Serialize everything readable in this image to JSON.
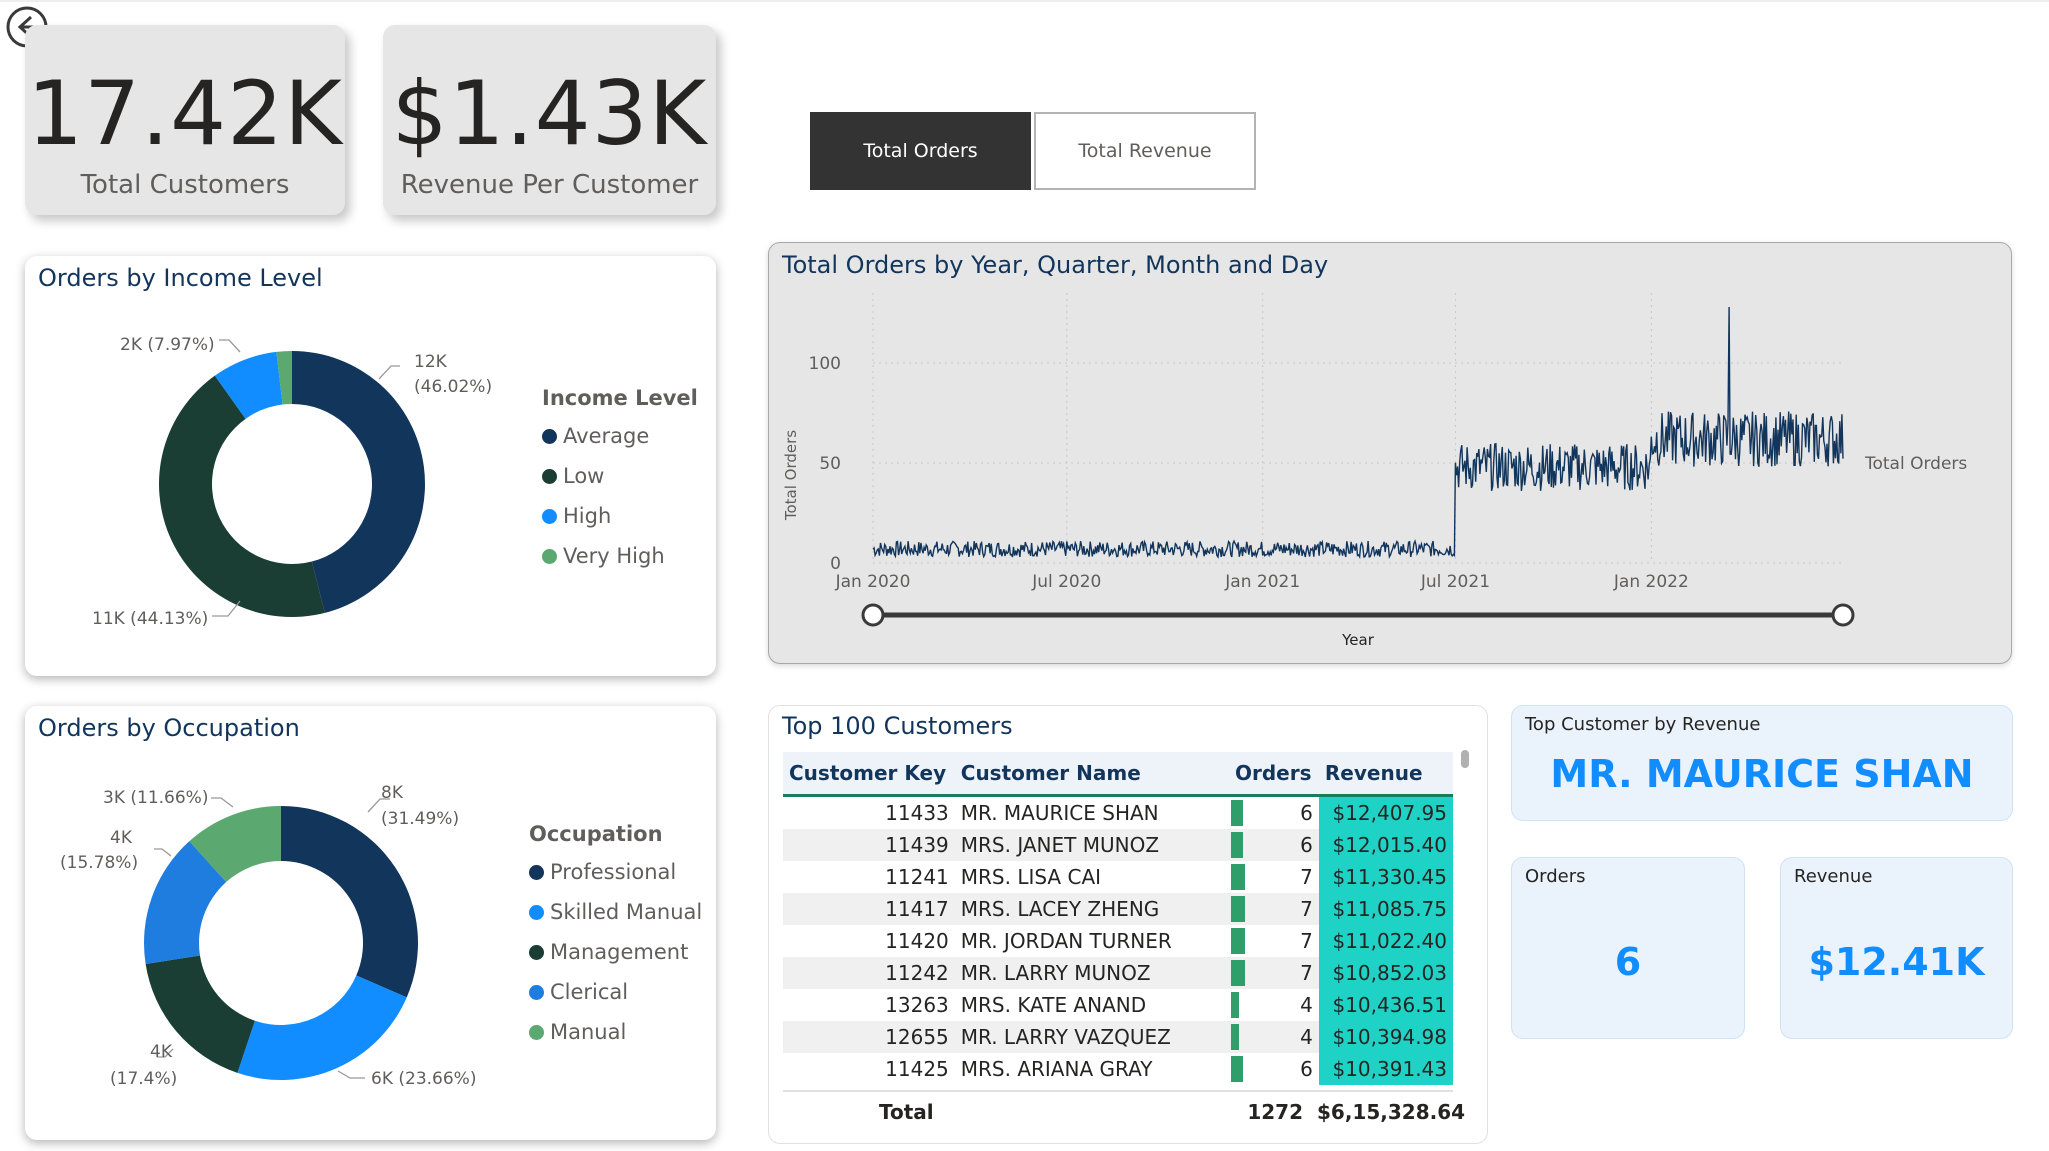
{
  "nav": {
    "back_icon": "back-arrow-icon"
  },
  "kpis": [
    {
      "value": "17.42K",
      "label": "Total Customers"
    },
    {
      "value": "$1.43K",
      "label": "Revenue Per Customer"
    }
  ],
  "toggle": {
    "orders_label": "Total Orders",
    "revenue_label": "Total Revenue",
    "active": "Total Orders"
  },
  "income_chart": {
    "title": "Orders by Income Level",
    "legend_title": "Income Level",
    "legend": [
      "Average",
      "Low",
      "High",
      "Very High"
    ],
    "colors": [
      "#12355b",
      "#1a3d34",
      "#118dff",
      "#5ba870"
    ],
    "labels": {
      "average": "12K",
      "average_pct": "(46.02%)",
      "low": "11K (44.13%)",
      "very_high": "2K (7.97%)"
    }
  },
  "occupation_chart": {
    "title": "Orders by Occupation",
    "legend_title": "Occupation",
    "legend": [
      "Professional",
      "Skilled Manual",
      "Management",
      "Clerical",
      "Manual"
    ],
    "colors": [
      "#12355b",
      "#118dff",
      "#1a3d34",
      "#1f7de0",
      "#5ba870"
    ],
    "labels": {
      "professional": "8K",
      "professional_pct": "(31.49%)",
      "skilled": "6K (23.66%)",
      "management": "4K",
      "management_pct": "(17.4%)",
      "clerical": "4K",
      "clerical_pct": "(15.78%)",
      "manual": "3K (11.66%)"
    }
  },
  "line_chart": {
    "title": "Total Orders by Year, Quarter, Month and Day",
    "ylabel": "Total Orders",
    "xlabel": "Year",
    "series_label": "Total Orders",
    "line_color": "#12355b"
  },
  "chart_data": [
    {
      "type": "pie",
      "title": "Orders by Income Level",
      "categories": [
        "Average",
        "Low",
        "High",
        "Very High"
      ],
      "values": [
        46.02,
        44.13,
        7.97,
        1.88
      ],
      "data_labels": [
        "12K (46.02%)",
        "11K (44.13%)",
        "",
        "2K (7.97%)"
      ]
    },
    {
      "type": "pie",
      "title": "Orders by Occupation",
      "categories": [
        "Professional",
        "Skilled Manual",
        "Management",
        "Clerical",
        "Manual"
      ],
      "values": [
        31.49,
        23.66,
        17.4,
        15.78,
        11.66
      ],
      "data_labels": [
        "8K (31.49%)",
        "6K (23.66%)",
        "4K (17.4%)",
        "4K (15.78%)",
        "3K (11.66%)"
      ]
    },
    {
      "type": "line",
      "title": "Total Orders by Year, Quarter, Month and Day",
      "xlabel": "",
      "ylabel": "Total Orders",
      "x_ticks": [
        "Jan 2020",
        "Jul 2020",
        "Jan 2021",
        "Jul 2021",
        "Jan 2022"
      ],
      "y_ticks": [
        0,
        50,
        100
      ],
      "ylim": [
        0,
        130
      ],
      "x_range": [
        "2020-01-01",
        "2022-06-30"
      ],
      "series": [
        {
          "name": "Total Orders",
          "segments": [
            {
              "from": "2020-01-01",
              "to": "2021-06-30",
              "base": 7,
              "noise": 4
            },
            {
              "from": "2021-07-01",
              "to": "2021-12-31",
              "base": 48,
              "noise": 12
            },
            {
              "from": "2022-01-01",
              "to": "2022-06-30",
              "base": 62,
              "noise": 14
            }
          ],
          "peak": {
            "x": "2022-03-15",
            "y": 128
          }
        }
      ]
    }
  ],
  "table": {
    "title": "Top 100 Customers",
    "columns": [
      "Customer Key",
      "Customer Name",
      "Orders",
      "Revenue"
    ],
    "rows": [
      [
        "11433",
        "MR. MAURICE SHAN",
        6,
        "$12,407.95"
      ],
      [
        "11439",
        "MRS. JANET MUNOZ",
        6,
        "$12,015.40"
      ],
      [
        "11241",
        "MRS. LISA CAI",
        7,
        "$11,330.45"
      ],
      [
        "11417",
        "MRS. LACEY ZHENG",
        7,
        "$11,085.75"
      ],
      [
        "11420",
        "MR. JORDAN TURNER",
        7,
        "$11,022.40"
      ],
      [
        "11242",
        "MR. LARRY MUNOZ",
        7,
        "$10,852.03"
      ],
      [
        "13263",
        "MRS. KATE ANAND",
        4,
        "$10,436.51"
      ],
      [
        "12655",
        "MR. LARRY VAZQUEZ",
        4,
        "$10,394.98"
      ],
      [
        "11425",
        "MRS. ARIANA GRAY",
        6,
        "$10,391.43"
      ]
    ],
    "total_label": "Total",
    "total_orders": "1272",
    "total_revenue": "$6,15,328.64"
  },
  "top_customer": {
    "caption": "Top Customer by Revenue",
    "name": "MR. MAURICE SHAN"
  },
  "orders_card": {
    "caption": "Orders",
    "value": "6"
  },
  "revenue_card": {
    "caption": "Revenue",
    "value": "$12.41K"
  }
}
